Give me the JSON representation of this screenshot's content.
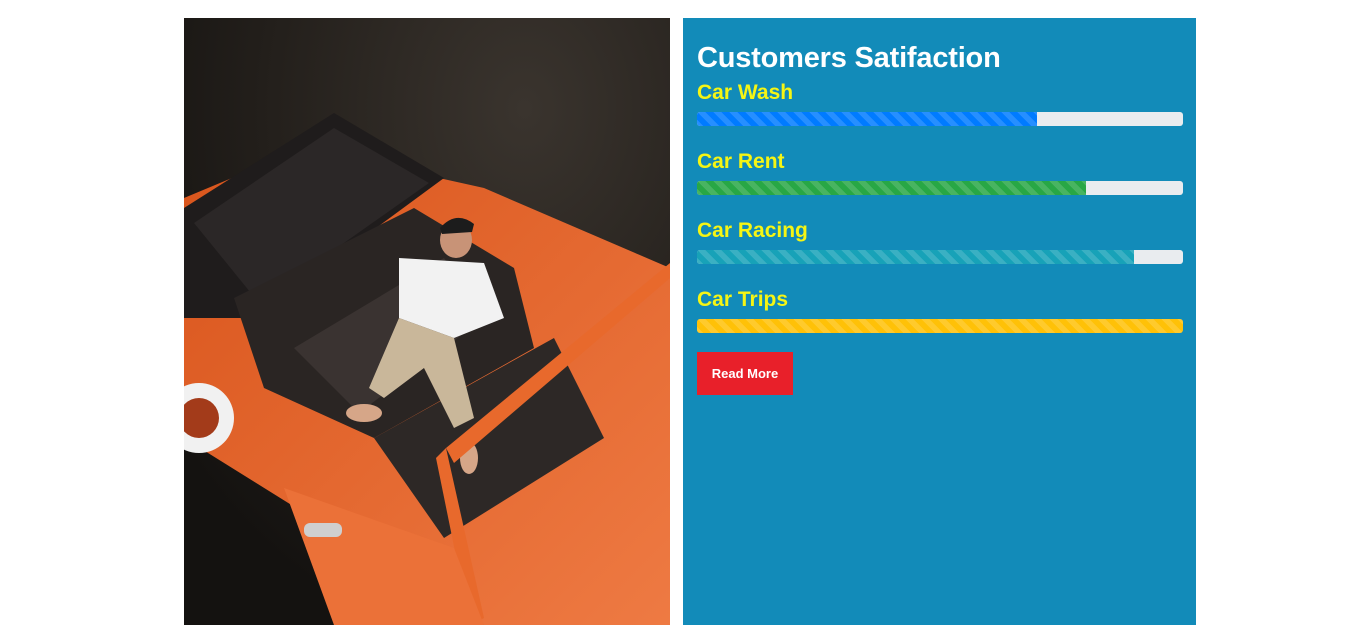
{
  "section": {
    "title": "Customers Satifaction",
    "read_more_label": "Read More",
    "photo_alt": "Man relaxing in orange convertible"
  },
  "skills": [
    {
      "label": "Car Wash",
      "percent": 70,
      "color": "#007bff"
    },
    {
      "label": "Car Rent",
      "percent": 80,
      "color": "#28a745"
    },
    {
      "label": "Car Racing",
      "percent": 90,
      "color": "#17a2b8"
    },
    {
      "label": "Car Trips",
      "percent": 100,
      "color": "#ffc107"
    }
  ],
  "colors": {
    "panel_bg": "#128bb9",
    "label_yellow": "#f5f514",
    "button_red": "#e8202a",
    "track": "#e9ecef"
  }
}
